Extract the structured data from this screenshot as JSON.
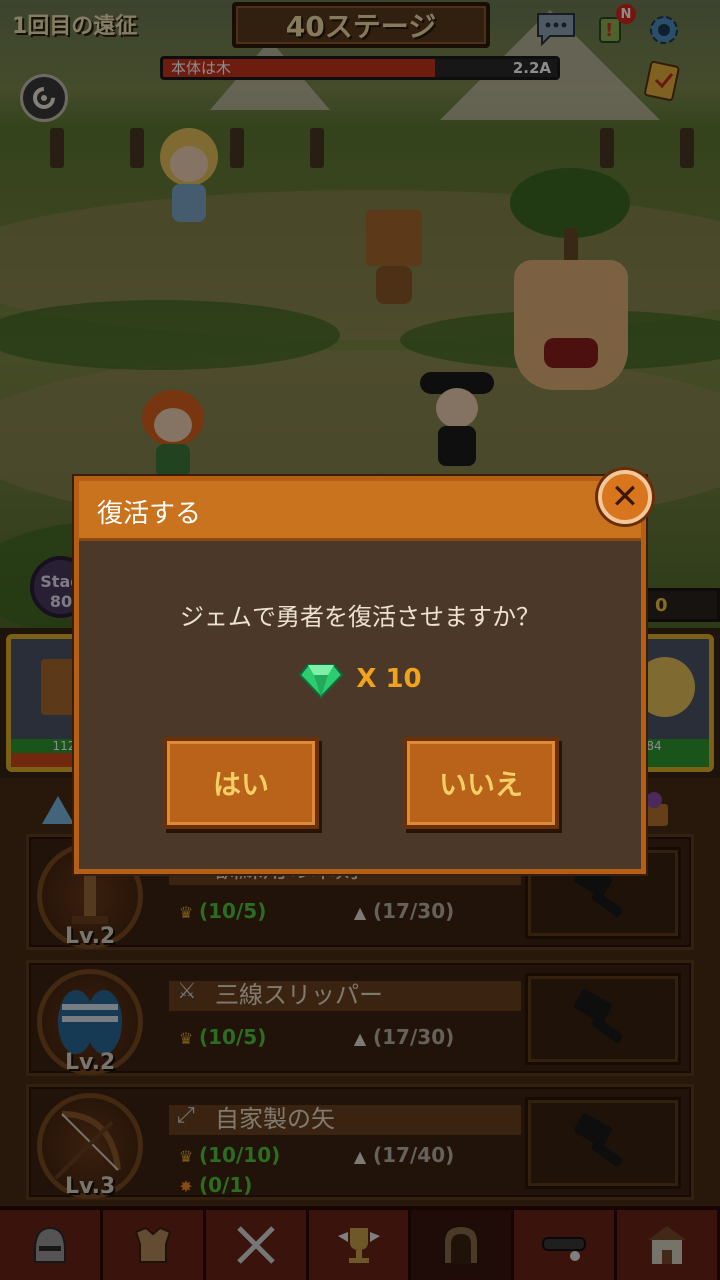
{
  "hud": {
    "expedition_label": "1回目の遠征",
    "stage_label": "40ステージ",
    "enemy_name": "本体は木",
    "enemy_hp": "2.2A",
    "enemy_hp_fraction": 0.69,
    "notification_badge": "N"
  },
  "side": {
    "stage_badge_prefix": "Stag",
    "stage_badge_value": "80",
    "gold_value": "0"
  },
  "heroes": [
    {
      "hp_text": "112/",
      "hp_fraction": 0.6
    },
    {
      "hp_text": "84",
      "hp_fraction": 1.0
    }
  ],
  "dialog": {
    "title": "復活する",
    "message": "ジェムで勇者を復活させますか？",
    "gem_cost": "X 10",
    "yes_label": "はい",
    "no_label": "いいえ",
    "close_icon": "close-icon"
  },
  "items": [
    {
      "name": "訓練用の木剣",
      "level": "Lv.2",
      "stat1": "(10/5)",
      "stat2": "(17/30)",
      "stat3": "",
      "type_icon": "sword-icon"
    },
    {
      "name": "三線スリッパー",
      "level": "Lv.2",
      "stat1": "(10/5)",
      "stat2": "(17/30)",
      "stat3": "",
      "type_icon": "swords-icon"
    },
    {
      "name": "自家製の矢",
      "level": "Lv.3",
      "stat1": "(10/10)",
      "stat2": "(17/40)",
      "stat3": "(0/1)",
      "type_icon": "bow-icon"
    }
  ],
  "nav": [
    "helmet-icon",
    "armor-icon",
    "swords-icon",
    "trophy-icon",
    "dungeon-icon",
    "collar-icon",
    "shop-icon"
  ],
  "colors": {
    "accent": "#c9731e",
    "gem": "#2ecc71",
    "gem_count": "#f3a21c",
    "stat_green": "#4fc93a"
  }
}
